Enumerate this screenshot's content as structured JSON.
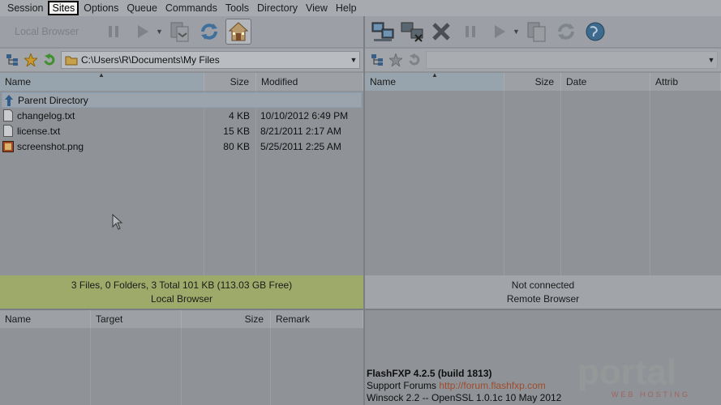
{
  "menu": {
    "items": [
      "Session",
      "Sites",
      "Options",
      "Queue",
      "Commands",
      "Tools",
      "Directory",
      "View",
      "Help"
    ],
    "active_index": 1
  },
  "toolbar_left": {
    "local_browser_label": "Local Browser"
  },
  "path_left": {
    "value": "C:\\Users\\R\\Documents\\My Files"
  },
  "path_right": {
    "value": ""
  },
  "local_pane": {
    "columns": {
      "name": "Name",
      "size": "Size",
      "modified": "Modified"
    },
    "rows": [
      {
        "name": "Parent Directory",
        "size": "",
        "modified": "",
        "icon": "up-arrow-icon"
      },
      {
        "name": "changelog.txt",
        "size": "4 KB",
        "modified": "10/10/2012 6:49 PM",
        "icon": "text-file-icon"
      },
      {
        "name": "license.txt",
        "size": "15 KB",
        "modified": "8/21/2011 2:17 AM",
        "icon": "text-file-icon"
      },
      {
        "name": "screenshot.png",
        "size": "80 KB",
        "modified": "5/25/2011 2:25 AM",
        "icon": "image-file-icon"
      }
    ],
    "status_line1": "3 Files, 0 Folders, 3 Total 101 KB (113.03 GB Free)",
    "status_line2": "Local Browser"
  },
  "remote_pane": {
    "columns": {
      "name": "Name",
      "size": "Size",
      "date": "Date",
      "attrib": "Attrib"
    },
    "status_line1": "Not connected",
    "status_line2": "Remote Browser"
  },
  "queue": {
    "columns": {
      "name": "Name",
      "target": "Target",
      "size": "Size",
      "remark": "Remark"
    }
  },
  "log": {
    "line1": "FlashFXP 4.2.5 (build 1813)",
    "line2_prefix": "Support Forums ",
    "line2_link": "http://forum.flashfxp.com",
    "line3": "Winsock 2.2 -- OpenSSL 1.0.1c 10 May 2012"
  },
  "watermark": {
    "brand": "portal",
    "tagline": "WEB HOSTING"
  },
  "colors": {
    "local_status_bg": "#9eaa6a",
    "remote_status_bg": "#a1a5aa",
    "accent_green": "#3f8f2f",
    "watermark_red": "#b03a2e"
  }
}
